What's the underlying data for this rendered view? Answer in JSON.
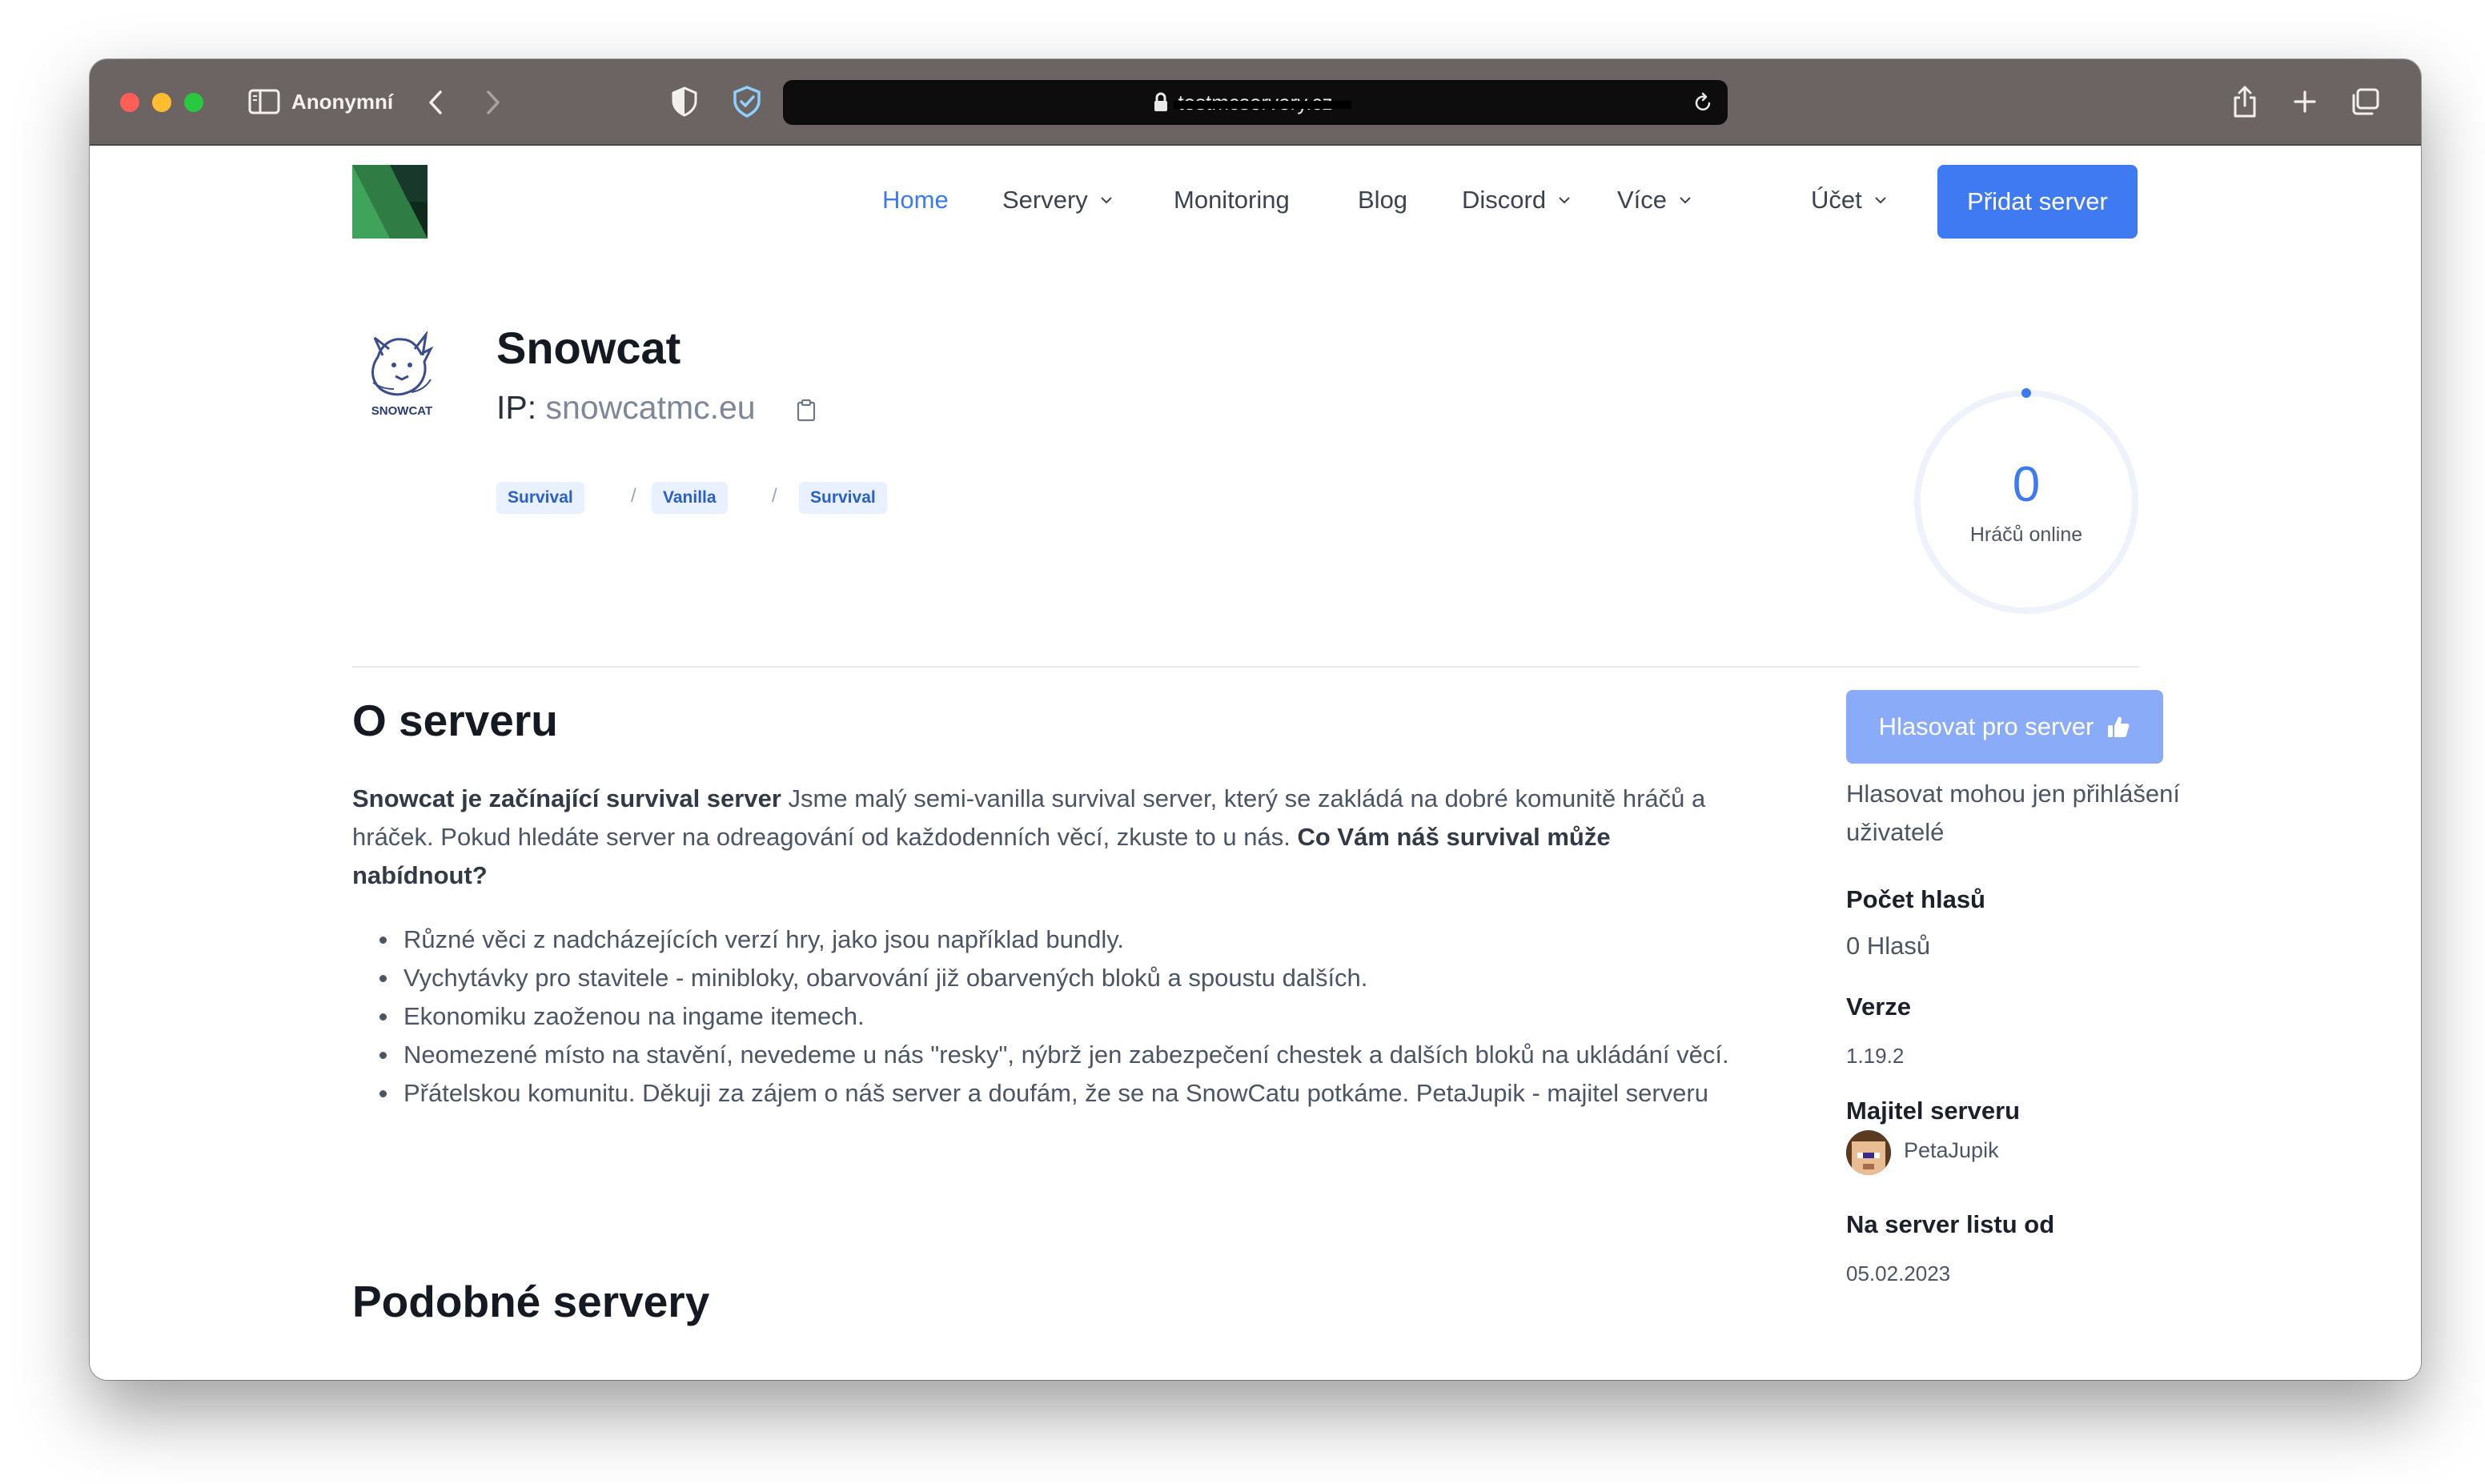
{
  "browser": {
    "profile_label": "Anonymní",
    "url_display": "testmcservery.cz",
    "icons": [
      "sidebar-toggle-icon",
      "back-icon",
      "forward-icon",
      "shield-icon",
      "adblock-shield-icon",
      "lock-icon",
      "reload-icon",
      "share-icon",
      "plus-icon",
      "tabs-icon"
    ]
  },
  "nav": {
    "items": [
      {
        "label": "Home",
        "active": true
      },
      {
        "label": "Servery",
        "dropdown": true
      },
      {
        "label": "Monitoring"
      },
      {
        "label": "Blog"
      },
      {
        "label": "Discord",
        "dropdown": true
      },
      {
        "label": "Více",
        "dropdown": true
      }
    ],
    "account_label": "Účet",
    "add_server_label": "Přidat server"
  },
  "server": {
    "name": "Snowcat",
    "logo_text": "SNOWCAT",
    "ip_label": "IP:",
    "ip_value": "snowcatmc.eu",
    "tags": [
      "Survival",
      "Vanilla",
      "Survival"
    ],
    "tag_separator": "/",
    "online_count": "0",
    "online_label": "Hráčů online"
  },
  "about": {
    "title": "O serveru",
    "intro_bold": "Snowcat je začínající survival server",
    "intro_text": " Jsme malý semi-vanilla survival server, který se zakládá na dobré komunitě hráčů a hráček. Pokud hledáte server na odreagování od každodenních věcí, zkuste to u nás. ",
    "question_bold": "Co Vám náš survival může nabídnout?",
    "features": [
      "Různé věci z nadcházejících verzí hry, jako jsou například bundly.",
      "Vychytávky pro stavitele - minibloky, obarvování již obarvených bloků a spoustu dalších.",
      "Ekonomiku zaoženou na ingame itemech.",
      "Neomezené místo na stavění, nevedeme u nás \"resky\", nýbrž jen zabezpečení chestek a dalších bloků na ukládání věcí.",
      "Přátelskou komunitu. Děkuji za zájem o náš server a doufám, že se na SnowCatu potkáme. PetaJupik - majitel serveru"
    ]
  },
  "sidebar": {
    "vote_label": "Hlasovat pro server",
    "vote_note": "Hlasovat mohou jen přihlášení uživatelé",
    "votes_title": "Počet hlasů",
    "votes_value": "0 Hlasů",
    "version_title": "Verze",
    "version_value": "1.19.2",
    "owner_title": "Majitel serveru",
    "owner_name": "PetaJupik",
    "listed_title": "Na server listu od",
    "listed_value": "05.02.2023"
  },
  "similar": {
    "title": "Podobné servery"
  },
  "colors": {
    "accent": "#3f7af2",
    "accent_disabled": "#8aabf7",
    "tag_bg": "#e9f0ff",
    "titlebar": "#6b6462"
  }
}
